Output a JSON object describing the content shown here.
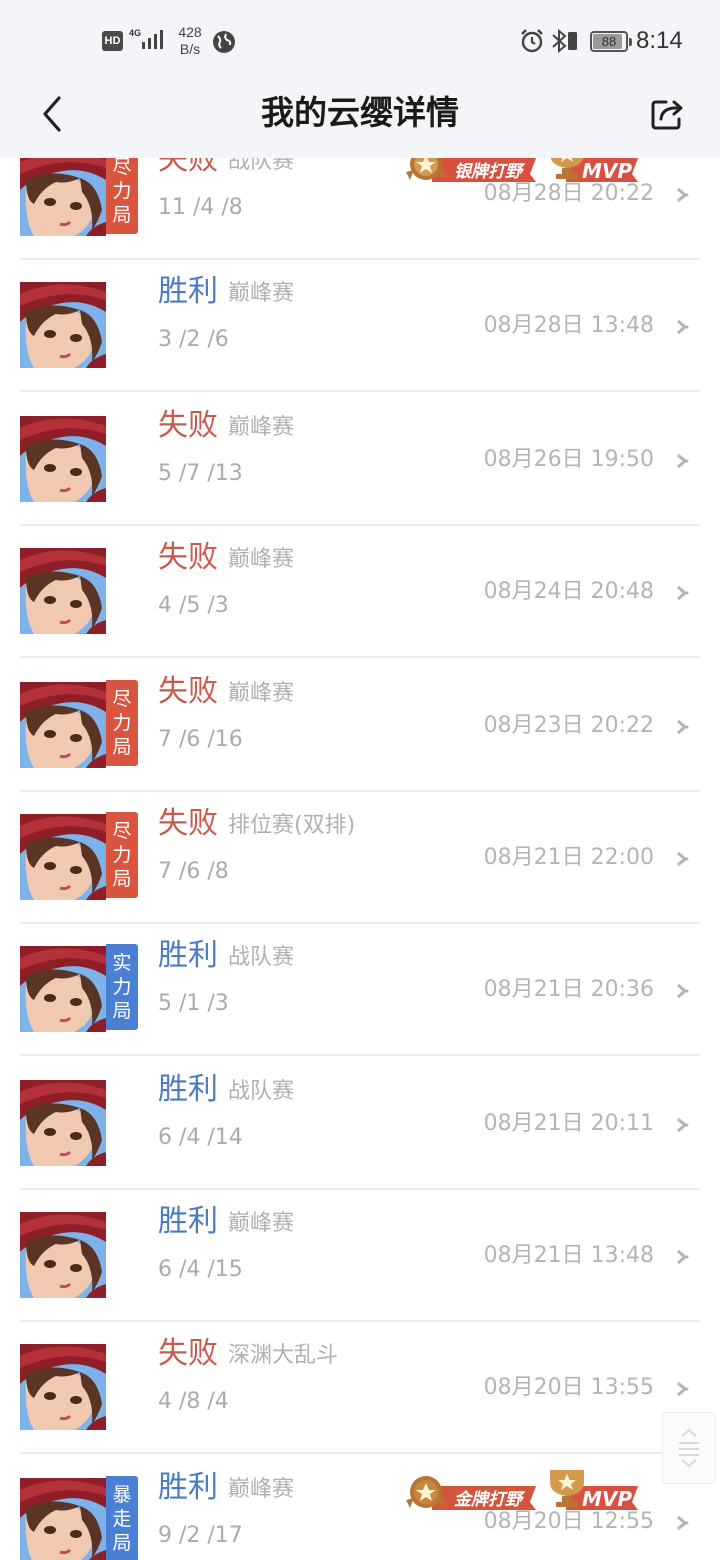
{
  "status_bar": {
    "hd": "HD",
    "network": "4G",
    "speed_value": "428",
    "speed_unit": "B/s",
    "battery": "88",
    "time": "8:14"
  },
  "nav": {
    "title": "我的云缨详情",
    "back_icon": "chevron-left-icon",
    "share_icon": "share-icon"
  },
  "badges": {
    "silver_jungle": "银牌打野",
    "gold_jungle": "金牌打野",
    "mvp": "MVP"
  },
  "matches": [
    {
      "result": "失败",
      "outcome": "lose",
      "mode": "战队赛",
      "kda": "11 /4 /8",
      "time": "08月28日 20:22",
      "tag": "尽力局",
      "tag_color": "red",
      "badge": "silver"
    },
    {
      "result": "胜利",
      "outcome": "win",
      "mode": "巅峰赛",
      "kda": "3 /2 /6",
      "time": "08月28日 13:48"
    },
    {
      "result": "失败",
      "outcome": "lose",
      "mode": "巅峰赛",
      "kda": "5 /7 /13",
      "time": "08月26日 19:50"
    },
    {
      "result": "失败",
      "outcome": "lose",
      "mode": "巅峰赛",
      "kda": "4 /5 /3",
      "time": "08月24日 20:48"
    },
    {
      "result": "失败",
      "outcome": "lose",
      "mode": "巅峰赛",
      "kda": "7 /6 /16",
      "time": "08月23日 20:22",
      "tag": "尽力局",
      "tag_color": "red"
    },
    {
      "result": "失败",
      "outcome": "lose",
      "mode": "排位赛(双排)",
      "kda": "7 /6 /8",
      "time": "08月21日 22:00",
      "tag": "尽力局",
      "tag_color": "red"
    },
    {
      "result": "胜利",
      "outcome": "win",
      "mode": "战队赛",
      "kda": "5 /1 /3",
      "time": "08月21日 20:36",
      "tag": "实力局",
      "tag_color": "blue"
    },
    {
      "result": "胜利",
      "outcome": "win",
      "mode": "战队赛",
      "kda": "6 /4 /14",
      "time": "08月21日 20:11"
    },
    {
      "result": "胜利",
      "outcome": "win",
      "mode": "巅峰赛",
      "kda": "6 /4 /15",
      "time": "08月21日 13:48"
    },
    {
      "result": "失败",
      "outcome": "lose",
      "mode": "深渊大乱斗",
      "kda": "4 /8 /4",
      "time": "08月20日 13:55"
    },
    {
      "result": "胜利",
      "outcome": "win",
      "mode": "巅峰赛",
      "kda": "9 /2 /17",
      "time": "08月20日 12:55",
      "tag": "暴走局",
      "tag_color": "blue",
      "badge": "gold"
    }
  ]
}
